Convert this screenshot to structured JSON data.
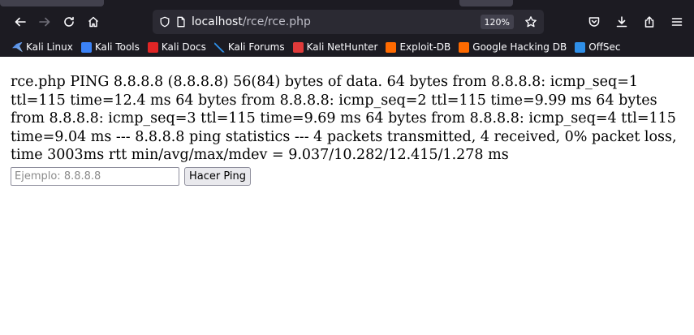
{
  "browser": {
    "url_host": "localhost",
    "url_path": "/rce/rce.php",
    "zoom": "120%",
    "bookmarks": [
      {
        "label": "Kali Linux",
        "icon": "kali-dragon-icon"
      },
      {
        "label": "Kali Tools",
        "icon": "kali-tools-icon"
      },
      {
        "label": "Kali Docs",
        "icon": "kali-docs-icon"
      },
      {
        "label": "Kali Forums",
        "icon": "kali-forums-icon"
      },
      {
        "label": "Kali NetHunter",
        "icon": "kali-nethunter-icon"
      },
      {
        "label": "Exploit-DB",
        "icon": "exploit-db-icon"
      },
      {
        "label": "Google Hacking DB",
        "icon": "ghdb-icon"
      },
      {
        "label": "OffSec",
        "icon": "offsec-icon"
      }
    ]
  },
  "page": {
    "output": "rce.php PING 8.8.8.8 (8.8.8.8) 56(84) bytes of data. 64 bytes from 8.8.8.8: icmp_seq=1 ttl=115 time=12.4 ms 64 bytes from 8.8.8.8: icmp_seq=2 ttl=115 time=9.99 ms 64 bytes from 8.8.8.8: icmp_seq=3 ttl=115 time=9.69 ms 64 bytes from 8.8.8.8: icmp_seq=4 ttl=115 time=9.04 ms --- 8.8.8.8 ping statistics --- 4 packets transmitted, 4 received, 0% packet loss, time 3003ms rtt min/avg/max/mdev = 9.037/10.282/12.415/1.278 ms",
    "input_value": "",
    "input_placeholder": "Ejemplo: 8.8.8.8",
    "button_label": "Hacer Ping"
  }
}
